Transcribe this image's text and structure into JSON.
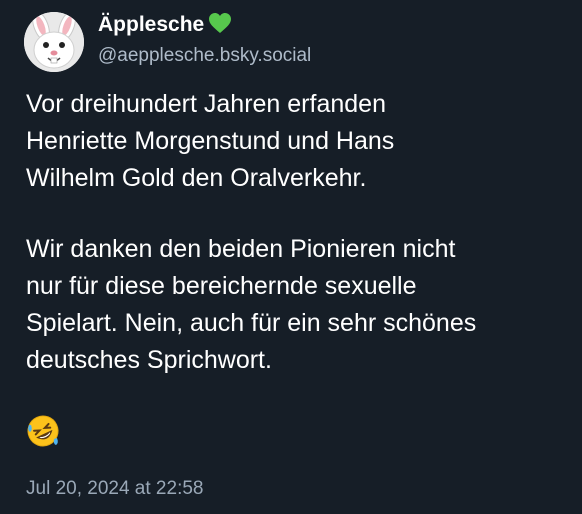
{
  "author": {
    "display_name": "Äpplesche",
    "verified_heart_icon": "green-heart-icon",
    "handle": "@aepplesche.bsky.social",
    "avatar_icon": "rabbit-avatar"
  },
  "post": {
    "paragraph_1": "Vor dreihundert Jahren erfanden\nHenriette Morgenstund und Hans\nWilhelm Gold den Oralverkehr.",
    "paragraph_2": "Wir danken den beiden Pionieren nicht\nnur für diese bereichernde sexuelle\nSpielart. Nein, auch für ein sehr schönes\ndeutsches Sprichwort.",
    "emoji_icon": "rolling-on-floor-laughing-emoji",
    "timestamp": "Jul 20, 2024 at 22:58"
  },
  "colors": {
    "background": "#161e27",
    "text": "#ffffff",
    "muted": "#aebbc9",
    "heart": "#57c84d"
  }
}
